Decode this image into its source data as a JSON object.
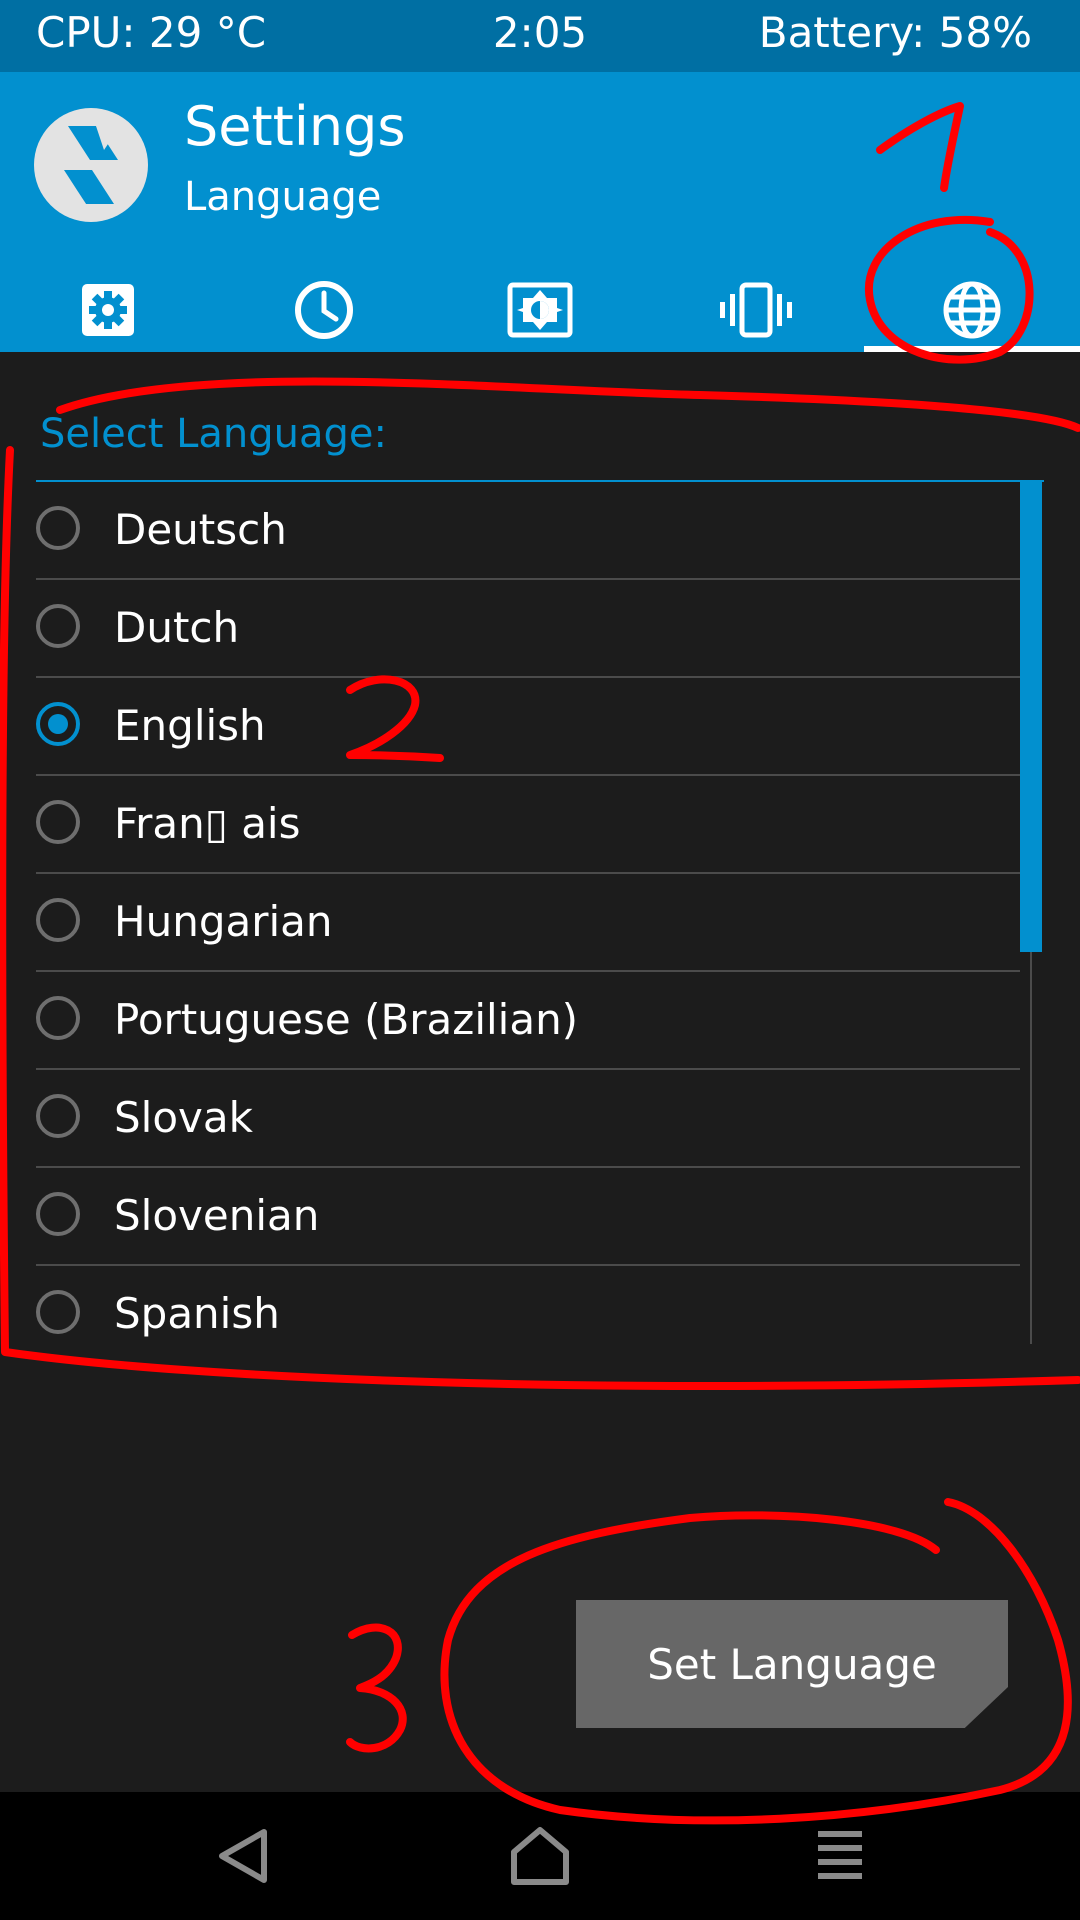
{
  "status_bar": {
    "cpu": "CPU: 29 °C",
    "time": "2:05",
    "battery": "Battery: 58%"
  },
  "header": {
    "title": "Settings",
    "subtitle": "Language"
  },
  "tabs": [
    {
      "icon": "gear-icon",
      "active": false
    },
    {
      "icon": "clock-icon",
      "active": false
    },
    {
      "icon": "brightness-icon",
      "active": false
    },
    {
      "icon": "vibrate-icon",
      "active": false
    },
    {
      "icon": "globe-icon",
      "active": true
    }
  ],
  "language_section": {
    "title": "Select Language:",
    "items": [
      {
        "label": "Deutsch",
        "selected": false
      },
      {
        "label": "Dutch",
        "selected": false
      },
      {
        "label": "English",
        "selected": true
      },
      {
        "label": "Fran▯ ais",
        "selected": false
      },
      {
        "label": "Hungarian",
        "selected": false
      },
      {
        "label": "Portuguese (Brazilian)",
        "selected": false
      },
      {
        "label": "Slovak",
        "selected": false
      },
      {
        "label": "Slovenian",
        "selected": false
      },
      {
        "label": "Spanish",
        "selected": false
      }
    ],
    "scroll_fraction_visible": 0.55
  },
  "set_button": {
    "label": "Set Language"
  },
  "nav_bar": {
    "items": [
      "back-icon",
      "home-icon",
      "menu-icon"
    ]
  },
  "annotations": {
    "marks": [
      "1",
      "2",
      "3"
    ],
    "color": "#ff0000"
  },
  "colors": {
    "accent": "#0290cf",
    "status_bar": "#006fa3",
    "background": "#1c1c1c",
    "button": "#676767"
  }
}
